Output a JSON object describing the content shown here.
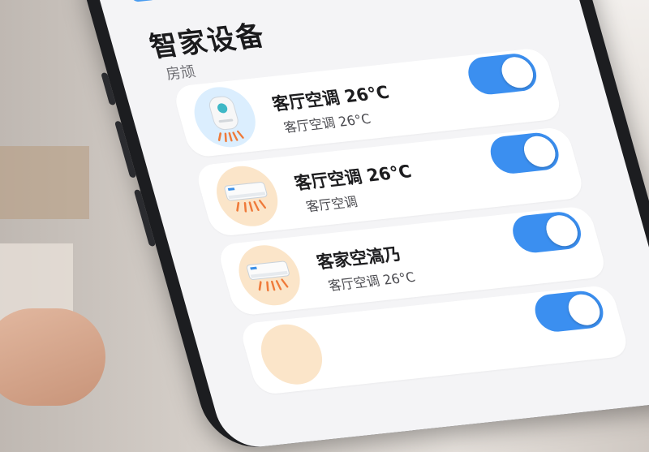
{
  "app": {
    "title": "智家设备"
  },
  "section": {
    "label": "房颃"
  },
  "devices": [
    {
      "name": "客厅空调 26°C",
      "subtitle": "客厅空调 26°C",
      "icon": "air-purifier-icon",
      "enabled": true
    },
    {
      "name": "客厅空调 26°C",
      "subtitle": "客厅空调",
      "icon": "air-conditioner-icon",
      "enabled": true
    },
    {
      "name": "客家空滈乃",
      "subtitle": "客厅空调 26°C",
      "icon": "air-conditioner-icon",
      "enabled": true
    },
    {
      "name": "",
      "subtitle": "",
      "icon": "air-conditioner-icon",
      "enabled": true
    }
  ],
  "colors": {
    "accent": "#3b8ff0",
    "card": "#ffffff",
    "screen": "#f4f4f6"
  }
}
